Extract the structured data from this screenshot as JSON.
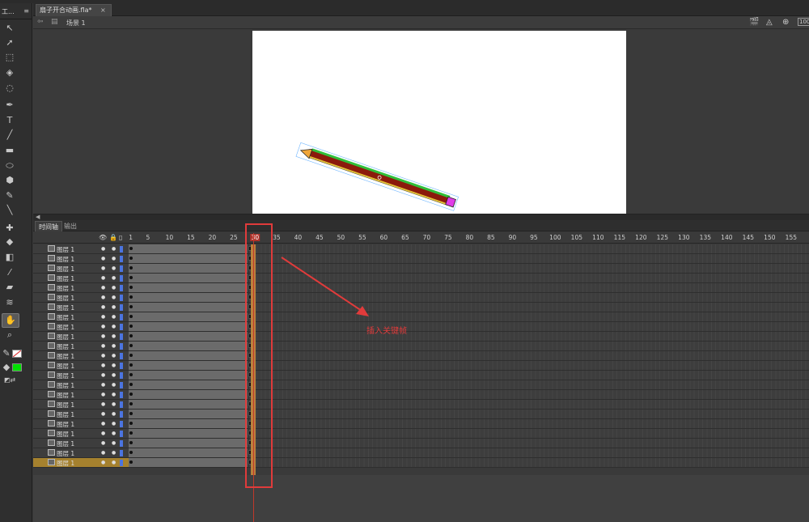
{
  "toolbox": {
    "title": "工...",
    "menu_icon": "panel-menu-icon"
  },
  "document": {
    "tab_title": "扇子开合动画.fla*",
    "close_label": "×"
  },
  "edit_bar": {
    "scene_label": "场景 1"
  },
  "timeline": {
    "tabs": [
      "时间轴",
      "输出"
    ],
    "ruler": [
      "1",
      "5",
      "10",
      "15",
      "20",
      "25",
      "30",
      "35",
      "40",
      "45",
      "50",
      "55",
      "60",
      "65",
      "70",
      "75",
      "80",
      "85",
      "90",
      "95",
      "100",
      "105",
      "110",
      "115",
      "120",
      "125",
      "130",
      "135",
      "140",
      "145",
      "150",
      "155"
    ],
    "current_frame": "30",
    "layers": [
      {
        "name": "图层 1"
      },
      {
        "name": "图层 1"
      },
      {
        "name": "图层 1"
      },
      {
        "name": "图层 1"
      },
      {
        "name": "图层 1"
      },
      {
        "name": "图层 1"
      },
      {
        "name": "图层 1"
      },
      {
        "name": "图层 1"
      },
      {
        "name": "图层 1"
      },
      {
        "name": "图层 1"
      },
      {
        "name": "图层 1"
      },
      {
        "name": "图层 1"
      },
      {
        "name": "图层 1"
      },
      {
        "name": "图层 1"
      },
      {
        "name": "图层 1"
      },
      {
        "name": "图层 1"
      },
      {
        "name": "图层 1"
      },
      {
        "name": "图层 1"
      },
      {
        "name": "图层 1"
      },
      {
        "name": "图层 1"
      },
      {
        "name": "图层 1"
      },
      {
        "name": "图层 1"
      },
      {
        "name": "图层 1"
      }
    ],
    "selected_layer_index": 22
  },
  "annotation": {
    "label": "插入关键帧",
    "color": "#e03b3b"
  },
  "colors": {
    "fill_swatch": "#00e000",
    "layer_color": "#4b74e0",
    "selected_layer": "#a5812e",
    "stage": "#ffffff"
  }
}
